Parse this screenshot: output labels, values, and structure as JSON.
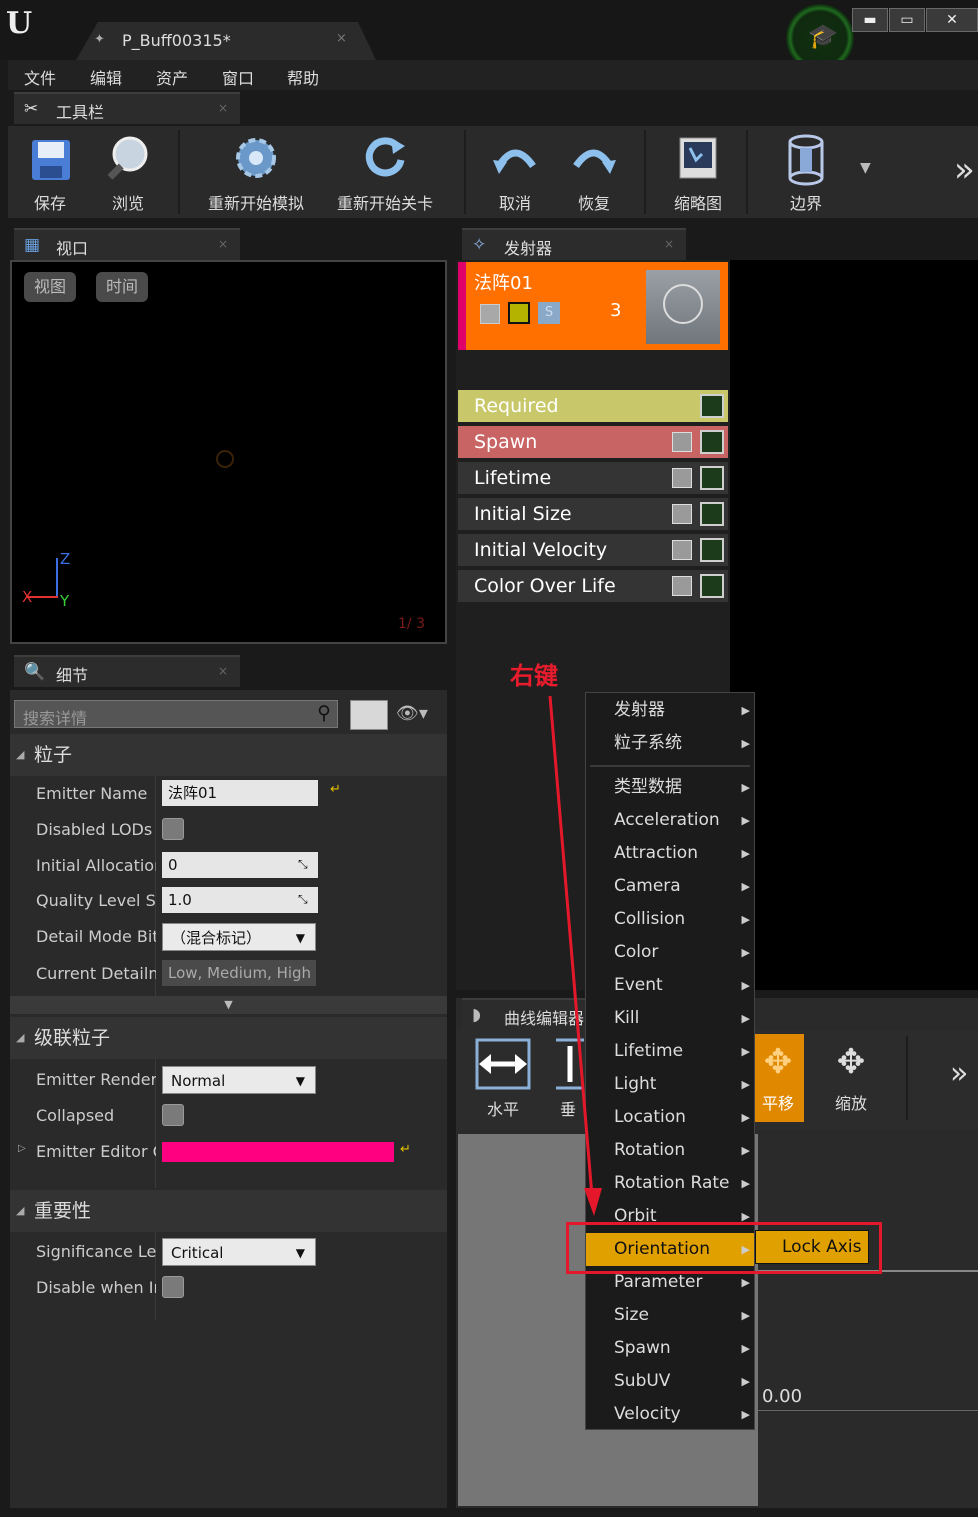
{
  "app": {
    "logo": "U",
    "doc_tab": "P_Buff00315*",
    "tab_close": "×",
    "window_min": "▬",
    "window_max": "▭",
    "window_close": "✕"
  },
  "menu": [
    "文件",
    "编辑",
    "资产",
    "窗口",
    "帮助"
  ],
  "panels": {
    "toolbar": "工具栏",
    "viewport": "视口",
    "emitters": "发射器",
    "details": "细节",
    "curve_editor": "曲线编辑器"
  },
  "toolbar": [
    {
      "label": "保存",
      "icon": "save-icon"
    },
    {
      "label": "浏览",
      "icon": "browse-icon"
    },
    {
      "label": "重新开始模拟",
      "icon": "restart-sim-icon"
    },
    {
      "label": "重新开始关卡",
      "icon": "restart-level-icon"
    },
    {
      "label": "取消",
      "icon": "undo-icon"
    },
    {
      "label": "恢复",
      "icon": "redo-icon"
    },
    {
      "label": "缩略图",
      "icon": "thumbnail-icon"
    },
    {
      "label": "边界",
      "icon": "bounds-icon"
    }
  ],
  "toolbar_more": "»",
  "viewport": {
    "view_btn": "视图",
    "time_btn": "时间",
    "axis_x": "X",
    "axis_y": "Y",
    "axis_z": "Z",
    "lod": "1/  3"
  },
  "emitter": {
    "name": "法阵01",
    "count": "3",
    "color": "#ff7000",
    "accent": "#e0006a",
    "solo_label": "S",
    "modules": [
      {
        "name": "Required",
        "bg": "#c8c86a",
        "fg": "#ffffff"
      },
      {
        "name": "Spawn",
        "bg": "#c86464",
        "fg": "#ffffff"
      },
      {
        "name": "Lifetime",
        "bg": "#343434",
        "fg": "#ffffff"
      },
      {
        "name": "Initial Size",
        "bg": "#343434",
        "fg": "#ffffff"
      },
      {
        "name": "Initial Velocity",
        "bg": "#343434",
        "fg": "#ffffff"
      },
      {
        "name": "Color Over Life",
        "bg": "#343434",
        "fg": "#ffffff"
      }
    ]
  },
  "details": {
    "search_placeholder": "搜索详情",
    "sections": {
      "particle": "粒子",
      "cascade": "级联粒子",
      "significance": "重要性"
    },
    "props": {
      "emitter_name": "Emitter Name",
      "emitter_name_val": "法阵01",
      "disabled_lods": "Disabled LODs K",
      "initial_allocation": "Initial Allocation",
      "initial_allocation_val": "0",
      "quality_level": "Quality Level Spa",
      "quality_level_val": "1.0",
      "detail_mode": "Detail Mode Bitm",
      "detail_mode_val": "（混合标记）",
      "current_detail": "Current Detailmo",
      "current_detail_val": "Low, Medium, High",
      "render_mode": "Emitter Render M",
      "render_mode_val": "Normal",
      "collapsed": "Collapsed",
      "editor_color": "Emitter Editor Co",
      "editor_color_val": "#ff0080",
      "significance_level": "Significance Leve",
      "significance_level_val": "Critical",
      "disable_when": "Disable when Ins"
    }
  },
  "curve": {
    "horizontal": "水平",
    "vertical": "垂",
    "pan": "平移",
    "zoom": "缩放",
    "value": "0.00",
    "more": "»"
  },
  "context_menu": {
    "items": [
      "发射器",
      "粒子系统",
      "类型数据",
      "Acceleration",
      "Attraction",
      "Camera",
      "Collision",
      "Color",
      "Event",
      "Kill",
      "Lifetime",
      "Light",
      "Location",
      "Rotation",
      "Rotation Rate",
      "Orbit",
      "Orientation",
      "Parameter",
      "Size",
      "Spawn",
      "SubUV",
      "Velocity"
    ],
    "highlighted": "Orientation",
    "submenu_item": "Lock Axis",
    "highlight_color": "#e0a000"
  },
  "annotation": {
    "label": "右键",
    "color": "#e81c2c"
  }
}
